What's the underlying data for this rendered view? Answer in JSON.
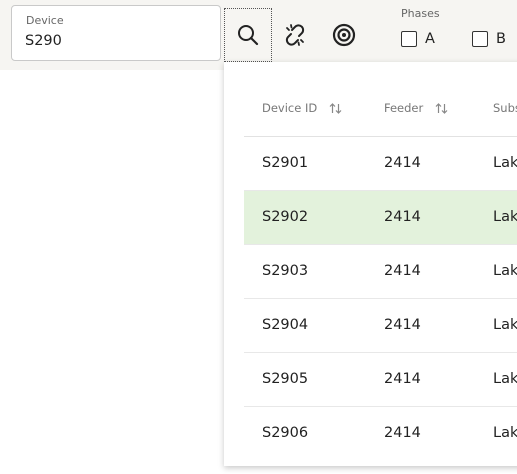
{
  "search": {
    "label": "Device",
    "value": "S290"
  },
  "toolbar": {
    "search_icon": "search-icon",
    "unlink_icon": "unlink-icon",
    "target_icon": "target-icon"
  },
  "phases": {
    "label": "Phases",
    "options": [
      {
        "label": "A",
        "checked": false
      },
      {
        "label": "B",
        "checked": false
      }
    ]
  },
  "table": {
    "columns": [
      "Device ID",
      "Feeder",
      "Subs"
    ],
    "rows": [
      {
        "device_id": "S2901",
        "feeder": "2414",
        "substation": "Lak",
        "selected": false
      },
      {
        "device_id": "S2902",
        "feeder": "2414",
        "substation": "Lak",
        "selected": true
      },
      {
        "device_id": "S2903",
        "feeder": "2414",
        "substation": "Lak",
        "selected": false
      },
      {
        "device_id": "S2904",
        "feeder": "2414",
        "substation": "Lak",
        "selected": false
      },
      {
        "device_id": "S2905",
        "feeder": "2414",
        "substation": "Lak",
        "selected": false
      },
      {
        "device_id": "S2906",
        "feeder": "2414",
        "substation": "Lak",
        "selected": false
      }
    ]
  },
  "colors": {
    "selected_row": "#e3f2dc",
    "toolbar_bg": "#f6f5f2"
  }
}
